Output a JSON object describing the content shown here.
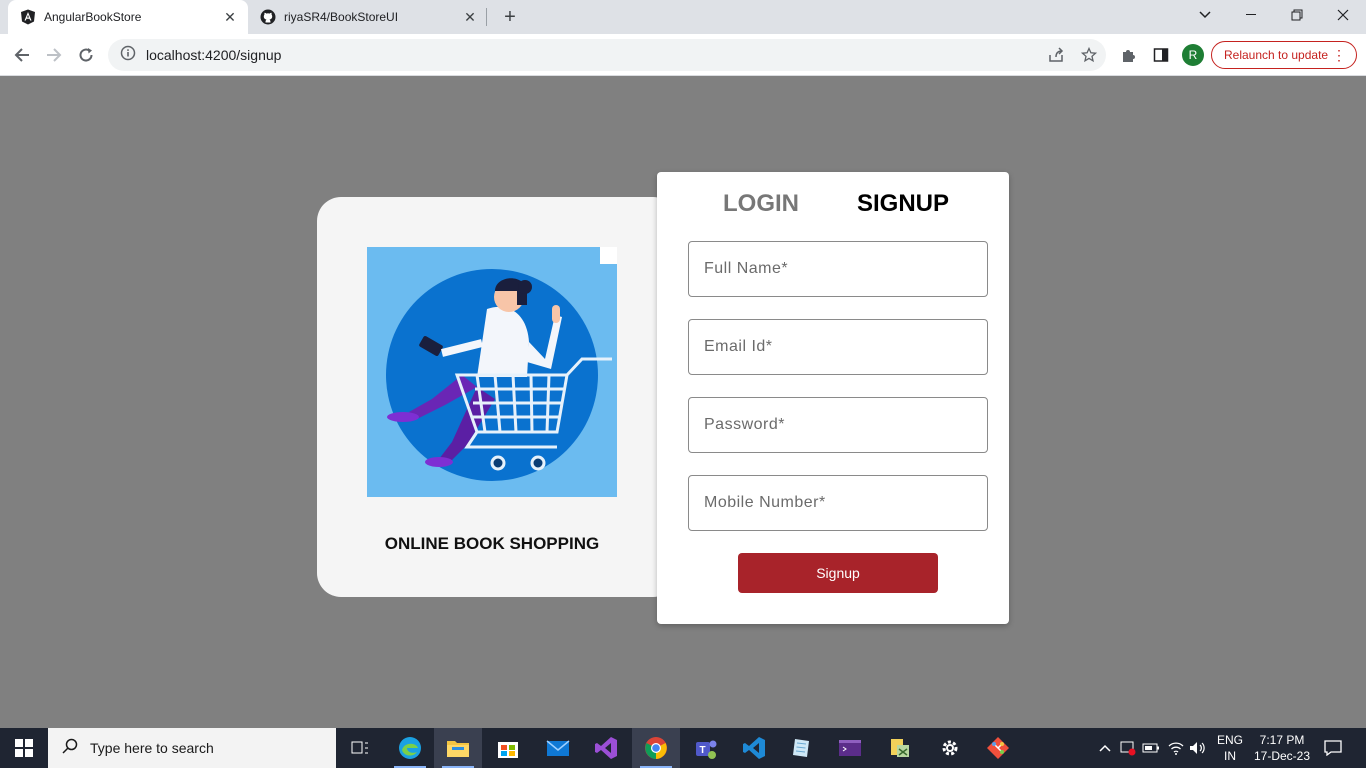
{
  "browser": {
    "tabs": [
      {
        "title": "AngularBookStore",
        "favicon": "angular-icon",
        "active": true
      },
      {
        "title": "riyaSR4/BookStoreUI",
        "favicon": "github-icon",
        "active": false
      }
    ],
    "url": "localhost:4200/signup",
    "relaunch_label": "Relaunch to update",
    "profile_initial": "R"
  },
  "left_panel": {
    "caption": "ONLINE BOOK SHOPPING",
    "illustration": "woman-in-shopping-cart"
  },
  "auth": {
    "tab_login": "LOGIN",
    "tab_signup": "SIGNUP",
    "active_tab": "SIGNUP",
    "fields": {
      "full_name_placeholder": "Full Name*",
      "email_placeholder": "Email Id*",
      "password_placeholder": "Password*",
      "mobile_placeholder": "Mobile Number*"
    },
    "submit_label": "Signup",
    "accent_color": "#a8232a"
  },
  "taskbar": {
    "search_placeholder": "Type here to search",
    "lang_top": "ENG",
    "lang_bottom": "IN",
    "time": "7:17 PM",
    "date": "17-Dec-23"
  }
}
